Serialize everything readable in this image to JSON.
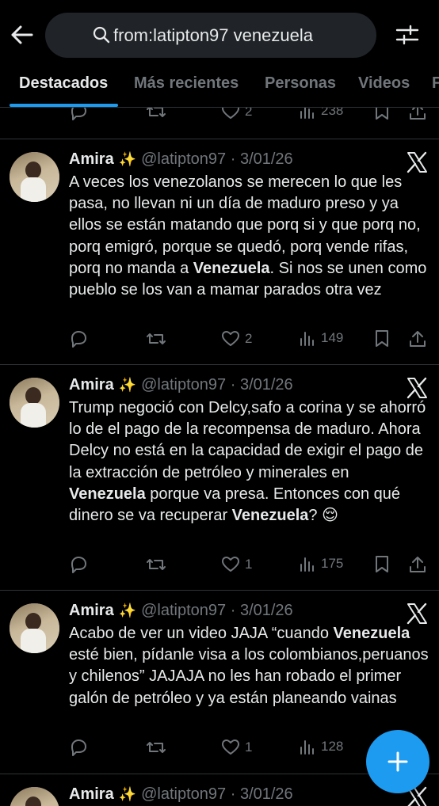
{
  "search": {
    "value": "from:latipton97 venezuela"
  },
  "tabs": [
    {
      "label": "Destacados",
      "active": true
    },
    {
      "label": "Más recientes",
      "active": false
    },
    {
      "label": "Personas",
      "active": false
    },
    {
      "label": "Videos",
      "active": false
    },
    {
      "label": "F",
      "active": false
    }
  ],
  "partial_tweet": {
    "likes": "2",
    "views": "238"
  },
  "tweets": [
    {
      "name": "Amira",
      "sparkle": "✨",
      "handle_date": "@latipton97 · 3/01/26",
      "text_parts": [
        "A veces los venezolanos se merecen lo que les pasa, no llevan ni un día de maduro preso y ya ellos se están matando que porq si y que porq no, porq emigró, porque se quedó, porq vende rifas, porq no manda a ",
        "Venezuela",
        ". Si nos se unen como pueblo se los van a mamar parados otra vez"
      ],
      "likes": "2",
      "views": "149"
    },
    {
      "name": "Amira",
      "sparkle": "✨",
      "handle_date": "@latipton97 · 3/01/26",
      "text_parts": [
        "Trump negoció con Delcy,safo a corina y se ahorró lo de el pago de la recompensa de maduro. Ahora Delcy no está en la capacidad de exigir el pago de la extracción de petróleo y minerales en ",
        "Venezuela",
        " porque va presa. Entonces con qué dinero se va recuperar ",
        "Venezuela",
        "? 😌"
      ],
      "likes": "1",
      "views": "175"
    },
    {
      "name": "Amira",
      "sparkle": "✨",
      "handle_date": "@latipton97 · 3/01/26",
      "text_parts": [
        "Acabo de ver un video JAJA “cuando ",
        "Venezuela",
        " esté bien, pídanle visa a los colombianos,peruanos y chilenos” JAJAJA no les han robado el primer galón de petróleo y ya están planeando vainas"
      ],
      "likes": "1",
      "views": "128"
    },
    {
      "name": "Amira",
      "sparkle": "✨",
      "handle_date": "@latipton97 · 3/01/26"
    }
  ],
  "icons": {
    "back": "arrow-left-icon",
    "search": "search-icon",
    "filter": "sliders-icon",
    "reply": "reply-icon",
    "retweet": "retweet-icon",
    "like": "heart-icon",
    "views": "views-icon",
    "bookmark": "bookmark-icon",
    "share": "share-icon",
    "x_logo": "x-logo-icon",
    "compose": "plus-icon"
  },
  "colors": {
    "accent": "#1d9bf0",
    "muted": "#71767b",
    "text": "#e7e9ea",
    "background": "#000000"
  }
}
